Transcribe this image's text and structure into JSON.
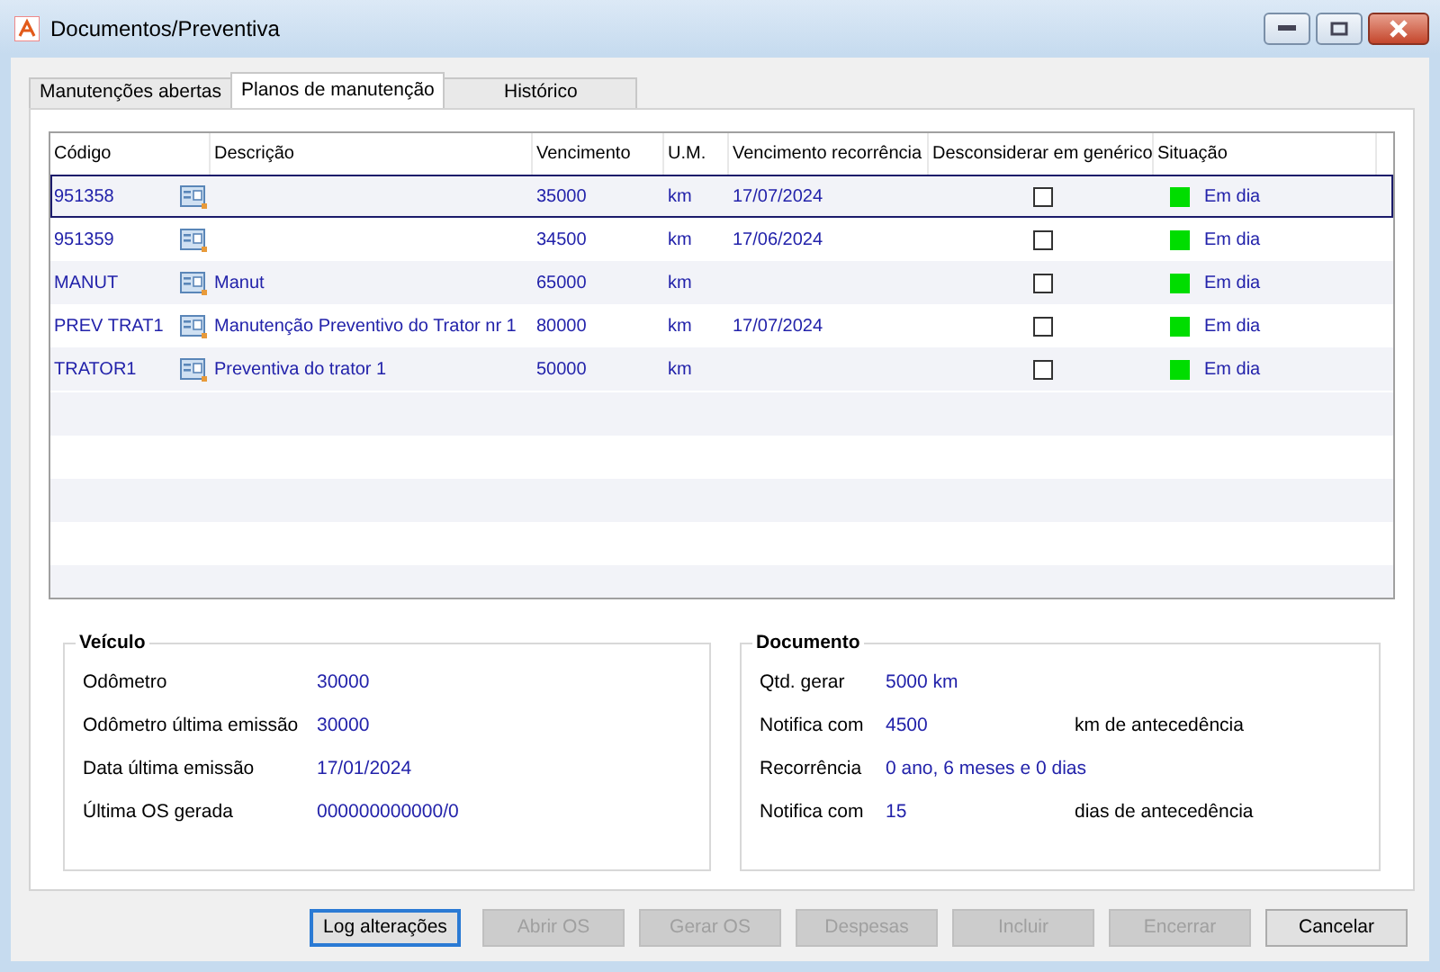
{
  "window": {
    "title": "Documentos/Preventiva"
  },
  "tabs": [
    {
      "label": "Manutenções abertas",
      "selected": false
    },
    {
      "label": "Planos de manutenção",
      "selected": true
    },
    {
      "label": "Histórico",
      "selected": false
    }
  ],
  "table": {
    "columns": [
      "Código",
      "Descrição",
      "Vencimento",
      "U.M.",
      "Vencimento recorrência",
      "Desconsiderar em genérico",
      "Situação"
    ],
    "rows": [
      {
        "codigo": "951358",
        "descricao": "",
        "vencimento": "35000",
        "um": "km",
        "recorrencia": "17/07/2024",
        "desconsiderar": false,
        "situacao": "Em dia",
        "color": "#00dd00",
        "selected": true
      },
      {
        "codigo": "951359",
        "descricao": "",
        "vencimento": "34500",
        "um": "km",
        "recorrencia": "17/06/2024",
        "desconsiderar": false,
        "situacao": "Em dia",
        "color": "#00dd00",
        "selected": false
      },
      {
        "codigo": "MANUT",
        "descricao": "Manut",
        "vencimento": "65000",
        "um": "km",
        "recorrencia": "",
        "desconsiderar": false,
        "situacao": "Em dia",
        "color": "#00dd00",
        "selected": false
      },
      {
        "codigo": "PREV TRAT1",
        "descricao": "Manutenção Preventivo do Trator nr 1",
        "vencimento": "80000",
        "um": "km",
        "recorrencia": "17/07/2024",
        "desconsiderar": false,
        "situacao": "Em dia",
        "color": "#00dd00",
        "selected": false
      },
      {
        "codigo": "TRATOR1",
        "descricao": "Preventiva do trator 1",
        "vencimento": "50000",
        "um": "km",
        "recorrencia": "",
        "desconsiderar": false,
        "situacao": "Em dia",
        "color": "#00dd00",
        "selected": false
      }
    ]
  },
  "veiculo": {
    "title": "Veículo",
    "fields": [
      {
        "label": "Odômetro",
        "value": "30000"
      },
      {
        "label": "Odômetro última emissão",
        "value": "30000"
      },
      {
        "label": "Data última emissão",
        "value": "17/01/2024"
      },
      {
        "label": "Última OS gerada",
        "value": "000000000000/0"
      }
    ]
  },
  "documento": {
    "title": "Documento",
    "fields": [
      {
        "label": "Qtd. gerar",
        "value": "5000 km"
      },
      {
        "label": "Notifica com",
        "value": "4500",
        "suffix": "km de antecedência"
      },
      {
        "label": "Recorrência",
        "value": "0 ano, 6 meses e 0 dias"
      },
      {
        "label": "Notifica com",
        "value": "15",
        "suffix": "dias de antecedência"
      }
    ]
  },
  "buttons": [
    {
      "label": "Log alterações",
      "disabled": false,
      "focused": true
    },
    {
      "label": "Abrir OS",
      "disabled": true,
      "focused": false
    },
    {
      "label": "Gerar OS",
      "disabled": true,
      "focused": false
    },
    {
      "label": "Despesas",
      "disabled": true,
      "focused": false
    },
    {
      "label": "Incluir",
      "disabled": true,
      "focused": false
    },
    {
      "label": "Encerrar",
      "disabled": true,
      "focused": false
    },
    {
      "label": "Cancelar",
      "disabled": false,
      "focused": false
    }
  ]
}
